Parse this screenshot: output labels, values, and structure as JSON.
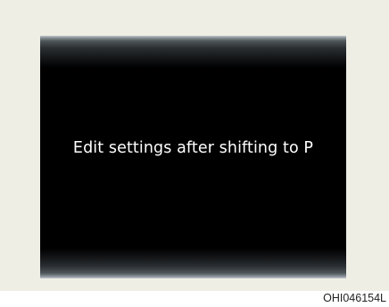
{
  "display": {
    "message": "Edit settings after shifting to P"
  },
  "figure": {
    "code": "OHI046154L"
  },
  "colors": {
    "background": "#efeee5",
    "screen": "#000000",
    "text": "#ffffff"
  }
}
